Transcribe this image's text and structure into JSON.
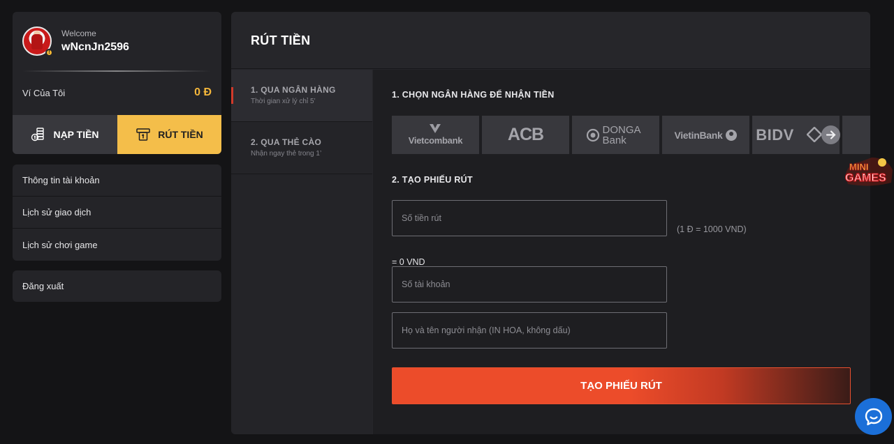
{
  "profile": {
    "welcome": "Welcome",
    "username": "wNcnJn2596",
    "wallet_label": "Ví Của Tôi",
    "wallet_value": "0 Đ"
  },
  "actions": {
    "deposit_label": "NẠP TIỀN",
    "withdraw_label": "RÚT TIỀN"
  },
  "menu": {
    "items": [
      {
        "label": "Thông tin tài khoản"
      },
      {
        "label": "Lịch sử giao dịch"
      },
      {
        "label": "Lịch sử chơi game"
      }
    ],
    "logout": "Đăng xuất"
  },
  "page": {
    "title": "RÚT TIỀN"
  },
  "methods": [
    {
      "title": "1. QUA NGÂN HÀNG",
      "subtitle": "Thời gian xử lý chỉ 5’",
      "active": true
    },
    {
      "title": "2. QUA THẺ CÀO",
      "subtitle": "Nhận ngay thẻ trong 1’",
      "active": false
    }
  ],
  "bank_section": {
    "title": "1. CHỌN NGÂN HÀNG ĐỂ NHẬN TIỀN",
    "banks": [
      "Vietcombank",
      "ACB",
      "DONGA Bank",
      "VietinBank",
      "BIDV"
    ]
  },
  "form": {
    "title": "2. TẠO PHIẾU RÚT",
    "amount_placeholder": "Số tiền rút",
    "rate_note": "(1 Đ = 1000 VND)",
    "converted": "= 0 VND",
    "account_placeholder": "Số tài khoản",
    "name_placeholder": "Họ và tên người nhận (IN HOA, không dấu)",
    "submit_label": "TẠO PHIẾU RÚT"
  },
  "brand": {
    "logo_text": "MINI GAMES"
  },
  "colors": {
    "accent_yellow": "#f4be4a",
    "accent_orange": "#ec4c2a",
    "wallet_gold": "#f3b63b",
    "chat_blue": "#1b6fd8"
  },
  "icons": [
    "coins-icon",
    "atm-withdraw-icon",
    "arrow-right-icon",
    "chat-icon"
  ]
}
